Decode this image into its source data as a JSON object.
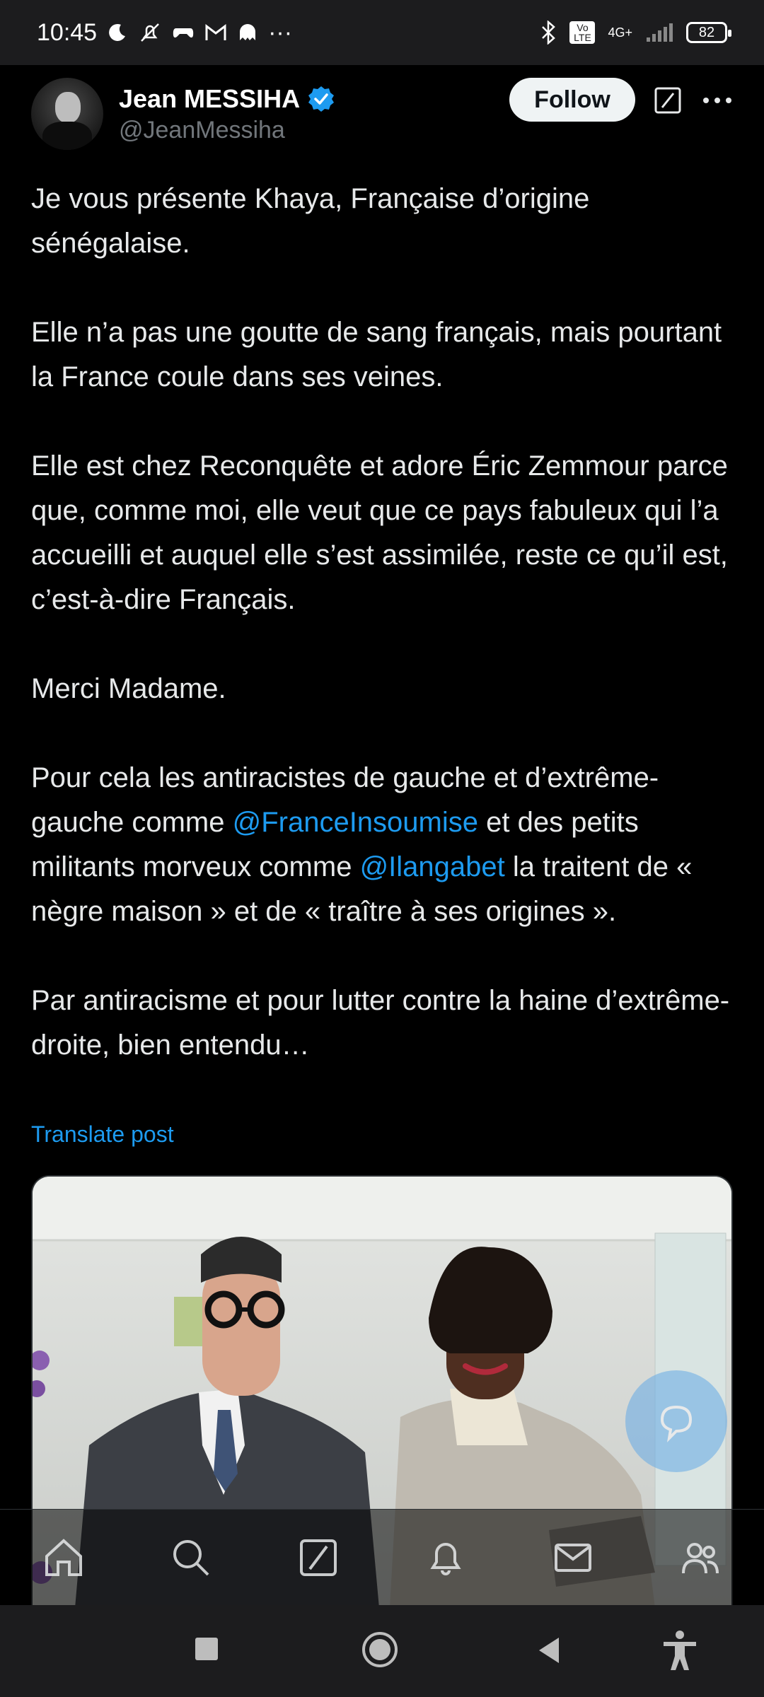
{
  "status_bar": {
    "time": "10:45",
    "battery": "82",
    "network": "4G+",
    "volte": "Vo LTE",
    "overflow": "···"
  },
  "header": {
    "author_name": "Jean MESSIHA",
    "author_handle": "@JeanMessiha",
    "follow_label": "Follow",
    "verified_color": "#1d9bf0"
  },
  "post": {
    "p1": "Je vous présente Khaya, Française d’origine sénégalaise.",
    "p2": "Elle n’a pas une goutte de sang français, mais pourtant la France coule dans ses veines.",
    "p3": "Elle est chez Reconquête et adore Éric Zemmour parce que, comme moi, elle veut que ce pays fabuleux qui l’a accueilli et auquel elle s’est assimilée, reste ce qu’il est, c’est-à-dire Français.",
    "p4": "Merci Madame.",
    "p5_a": "Pour cela les antiracistes de gauche et d’extrême-gauche comme ",
    "p5_mention1": "@FranceInsoumise",
    "p5_b": " et des petits militants morveux comme ",
    "p5_mention2": "@Ilangabet",
    "p5_c": " la traitent de « nègre maison » et de « traître à ses origines ».",
    "p6": "Par antiracisme et pour lutter contre la haine d’extrême-droite, bien entendu…",
    "translate_label": "Translate post"
  },
  "bottom_nav": {
    "items": [
      "home-icon",
      "search-icon",
      "grok-icon",
      "notifications-icon",
      "messages-icon",
      "communities-icon"
    ]
  },
  "system_nav": {
    "items": [
      "recents-icon",
      "home-icon",
      "back-icon",
      "accessibility-icon"
    ]
  },
  "colors": {
    "accent": "#1d9bf0",
    "background": "#000000",
    "text": "#e7e9ea",
    "secondary_text": "#71767b"
  }
}
